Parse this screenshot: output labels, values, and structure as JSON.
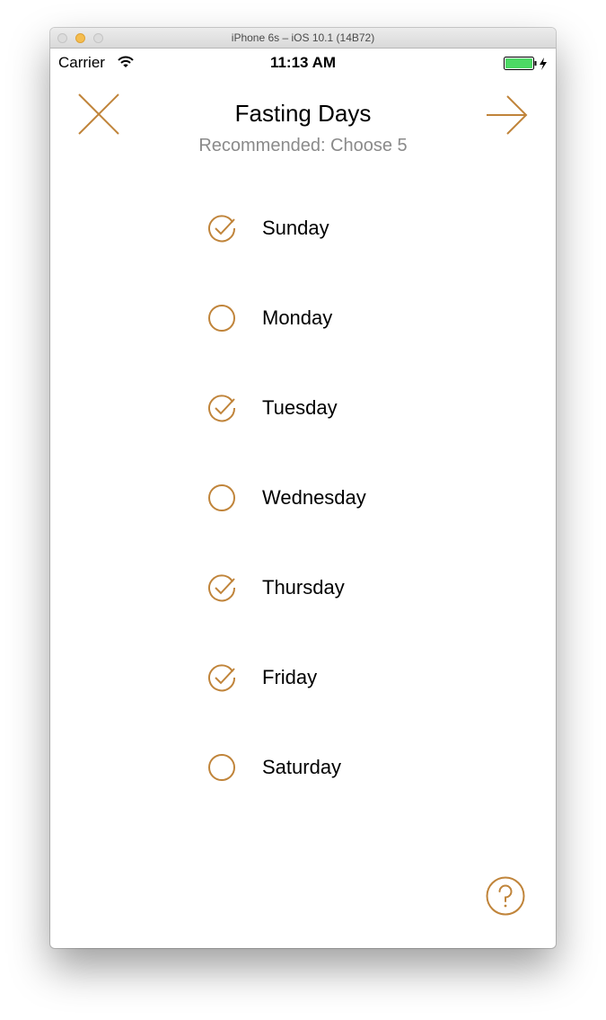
{
  "window": {
    "title": "iPhone 6s – iOS 10.1 (14B72)"
  },
  "statusbar": {
    "carrier": "Carrier",
    "time": "11:13 AM"
  },
  "header": {
    "title": "Fasting Days",
    "subtitle": "Recommended: Choose 5"
  },
  "days": [
    {
      "label": "Sunday",
      "checked": true
    },
    {
      "label": "Monday",
      "checked": false
    },
    {
      "label": "Tuesday",
      "checked": true
    },
    {
      "label": "Wednesday",
      "checked": false
    },
    {
      "label": "Thursday",
      "checked": true
    },
    {
      "label": "Friday",
      "checked": true
    },
    {
      "label": "Saturday",
      "checked": false
    }
  ],
  "icons": {
    "close": "close-icon",
    "next": "arrow-right-icon",
    "help": "question-icon",
    "checked": "checkmark-circle-icon",
    "unchecked": "empty-circle-icon"
  },
  "colors": {
    "accent": "#C0843A",
    "battery": "#4CD964",
    "subtitle": "#8A8A8A"
  }
}
